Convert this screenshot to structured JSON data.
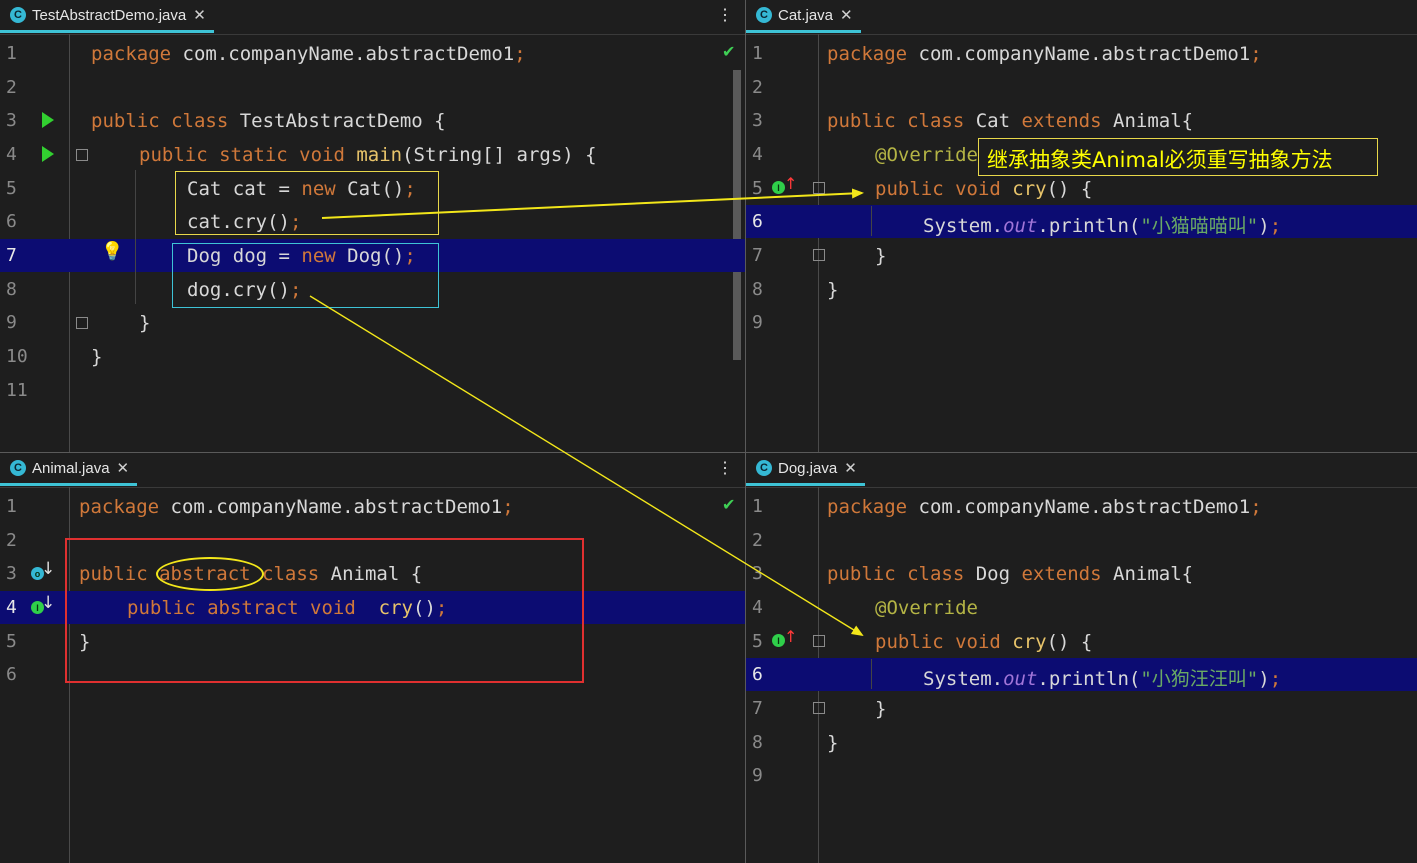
{
  "panes": {
    "test": {
      "tab_label": "TestAbstractDemo.java",
      "tab_icon": "class-icon",
      "lines": [
        {
          "num": "1",
          "code": "package com.companyName.abstractDemo1;"
        },
        {
          "num": "2",
          "code": ""
        },
        {
          "num": "3",
          "code": "public class TestAbstractDemo {"
        },
        {
          "num": "4",
          "code": "    public static void main(String[] args) {"
        },
        {
          "num": "5",
          "code": "        Cat cat = new Cat();"
        },
        {
          "num": "6",
          "code": "        cat.cry();"
        },
        {
          "num": "7",
          "code": "        Dog dog = new Dog();"
        },
        {
          "num": "8",
          "code": "        dog.cry();"
        },
        {
          "num": "9",
          "code": "    }"
        },
        {
          "num": "10",
          "code": "}"
        },
        {
          "num": "11",
          "code": ""
        }
      ]
    },
    "cat": {
      "tab_label": "Cat.java",
      "tab_icon": "class-icon",
      "lines": [
        {
          "num": "1",
          "code": "package com.companyName.abstractDemo1;"
        },
        {
          "num": "2",
          "code": ""
        },
        {
          "num": "3",
          "code": "public class Cat extends Animal{"
        },
        {
          "num": "4",
          "code": "    @Override"
        },
        {
          "num": "5",
          "code": "    public void cry() {"
        },
        {
          "num": "6",
          "code": "        System.out.println(\"小猫喵喵叫\");"
        },
        {
          "num": "7",
          "code": "    }"
        },
        {
          "num": "8",
          "code": "}"
        },
        {
          "num": "9",
          "code": ""
        }
      ],
      "callout": "继承抽象类Animal必须重写抽象方法"
    },
    "animal": {
      "tab_label": "Animal.java",
      "tab_icon": "class-icon",
      "lines": [
        {
          "num": "1",
          "code": "package com.companyName.abstractDemo1;"
        },
        {
          "num": "2",
          "code": ""
        },
        {
          "num": "3",
          "code": "public abstract class Animal {"
        },
        {
          "num": "4",
          "code": "    public abstract void  cry();"
        },
        {
          "num": "5",
          "code": "}"
        },
        {
          "num": "6",
          "code": ""
        }
      ]
    },
    "dog": {
      "tab_label": "Dog.java",
      "tab_icon": "class-icon",
      "lines": [
        {
          "num": "1",
          "code": "package com.companyName.abstractDemo1;"
        },
        {
          "num": "2",
          "code": ""
        },
        {
          "num": "3",
          "code": "public class Dog extends Animal{"
        },
        {
          "num": "4",
          "code": "    @Override"
        },
        {
          "num": "5",
          "code": "    public void cry() {"
        },
        {
          "num": "6",
          "code": "        System.out.println(\"小狗汪汪叫\");"
        },
        {
          "num": "7",
          "code": "    }"
        },
        {
          "num": "8",
          "code": "}"
        },
        {
          "num": "9",
          "code": ""
        }
      ]
    }
  },
  "colors": {
    "editor_bg": "#1e1e1e",
    "highlight_line": "#0c0c72",
    "keyword": "#d0783a",
    "annotation": "#b4b445",
    "string": "#6aaa64",
    "annotation_yellow": "#ffff00",
    "annotation_red": "#e03030",
    "annotation_cyan": "#3ec3d6"
  }
}
